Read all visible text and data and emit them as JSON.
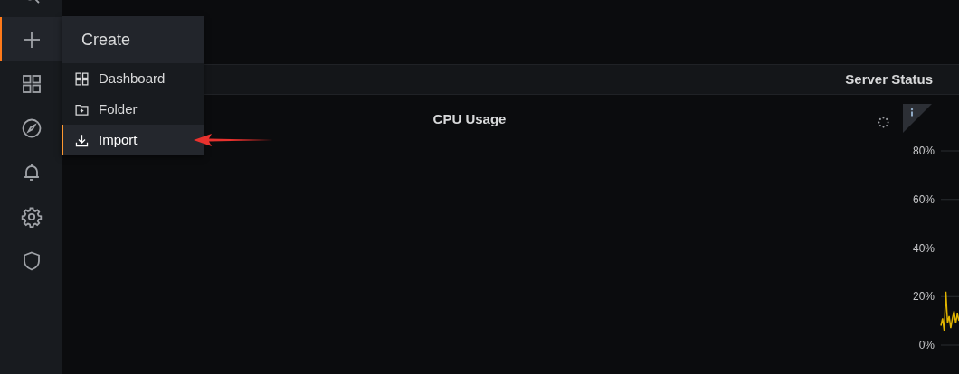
{
  "sidebar": {
    "items": [
      {
        "kind": "search",
        "selected": false
      },
      {
        "kind": "plus",
        "selected": true
      },
      {
        "kind": "grid",
        "selected": false
      },
      {
        "kind": "compass",
        "selected": false
      },
      {
        "kind": "bell",
        "selected": false
      },
      {
        "kind": "gear",
        "selected": false
      },
      {
        "kind": "shield",
        "selected": false
      }
    ]
  },
  "menu": {
    "title": "Create",
    "items": [
      {
        "label": "Dashboard",
        "kind": "grid",
        "selected": false
      },
      {
        "label": "Folder",
        "kind": "folder",
        "selected": false
      },
      {
        "label": "Import",
        "kind": "import",
        "selected": true
      }
    ]
  },
  "row": {
    "title": "Server Status"
  },
  "panel": {
    "title": "CPU Usage",
    "loading": true,
    "y_axis_labels": [
      "80%",
      "60%",
      "40%",
      "20%",
      "0%"
    ]
  }
}
